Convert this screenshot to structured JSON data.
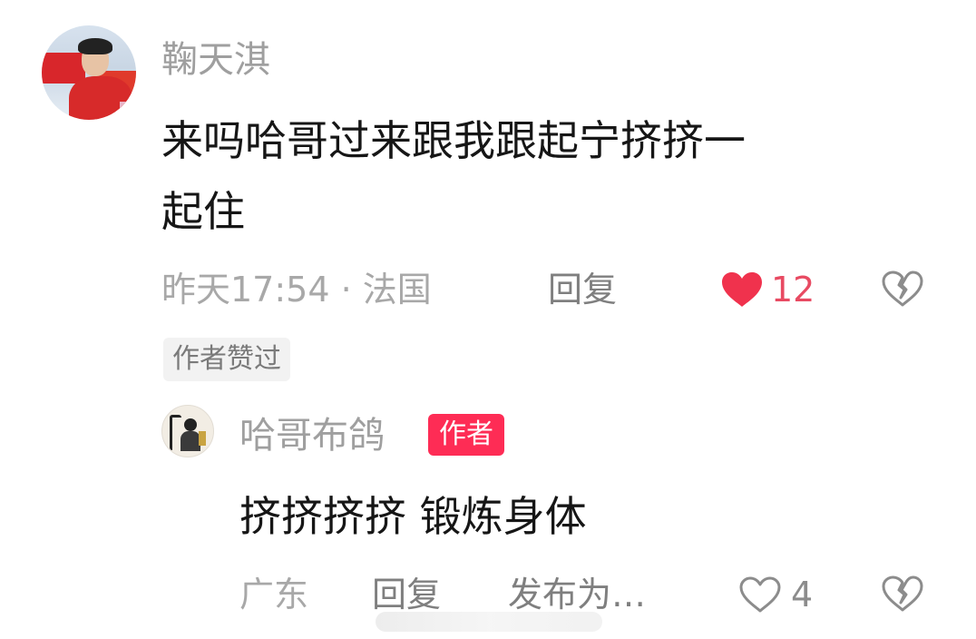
{
  "comments": [
    {
      "username": "鞠天淇",
      "text_line1": "来吗哈哥过来跟我跟起宁挤挤一",
      "text_line2": "起住",
      "meta": "昨天17:54 · 法国",
      "reply_label": "回复",
      "like_count": "12",
      "liked": true,
      "author_liked_badge": "作者赞过",
      "like_icon": "heart-filled-icon",
      "dislike_icon": "broken-heart-icon"
    }
  ],
  "reply": {
    "username": "哈哥布鸽",
    "author_badge": "作者",
    "text": "挤挤挤挤 锻炼身体",
    "location": "广东",
    "reply_label": "回复",
    "publish_label": "发布为…",
    "like_count": "4",
    "liked": false,
    "like_icon": "heart-outline-icon",
    "dislike_icon": "broken-heart-icon"
  },
  "colors": {
    "like_red": "#fe2c55",
    "heart_red": "#f0324d",
    "meta_gray": "#a8a8a8",
    "text_dark": "#161616"
  }
}
